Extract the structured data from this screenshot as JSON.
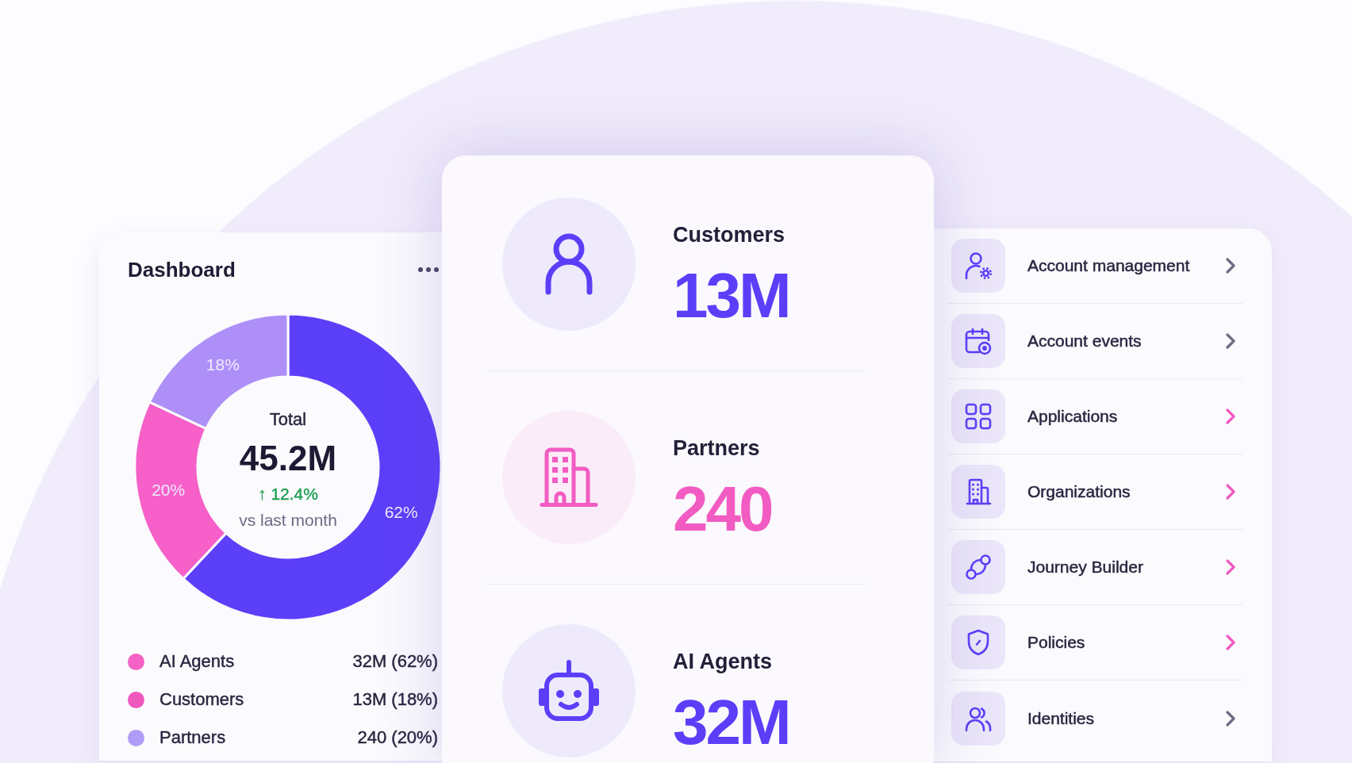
{
  "dashboard": {
    "title": "Dashboard",
    "chart_data": [
      {
        "type": "donut",
        "values": [
          62,
          20,
          18
        ],
        "colors": [
          "#5c3ff9",
          "#f660c8",
          "#ae8ff8"
        ],
        "value_labels": [
          "62%",
          "20%",
          "18%"
        ]
      }
    ],
    "total": {
      "label": "Total",
      "value": "45.2M",
      "change": "↑ 12.4%",
      "period": "vs last month"
    },
    "legend": [
      {
        "label": "AI Agents",
        "value": "32M (62%)",
        "color": "#f462c6"
      },
      {
        "label": "Customers",
        "value": "13M (18%)",
        "color": "#ef59be"
      },
      {
        "label": "Partners",
        "value": "240 (20%)",
        "color": "#b09cf7"
      }
    ]
  },
  "stats": [
    {
      "label": "Customers",
      "value": "13M",
      "color": "#5b3ff8"
    },
    {
      "label": "Partners",
      "value": "240",
      "color": "#f25cc2"
    },
    {
      "label": "AI Agents",
      "value": "32M",
      "color": "#5b3ff8"
    }
  ],
  "nav_items": [
    {
      "label": "Account management",
      "color": "#6e6b83"
    },
    {
      "label": "Account events",
      "color": "#6e6b83"
    },
    {
      "label": "Applications",
      "color": "#f159c0"
    },
    {
      "label": "Organizations",
      "color": "#f159c0"
    },
    {
      "label": "Journey Builder",
      "color": "#f159c0"
    },
    {
      "label": "Policies",
      "color": "#f159c0"
    },
    {
      "label": "Identities",
      "color": "#6e6b83"
    }
  ]
}
